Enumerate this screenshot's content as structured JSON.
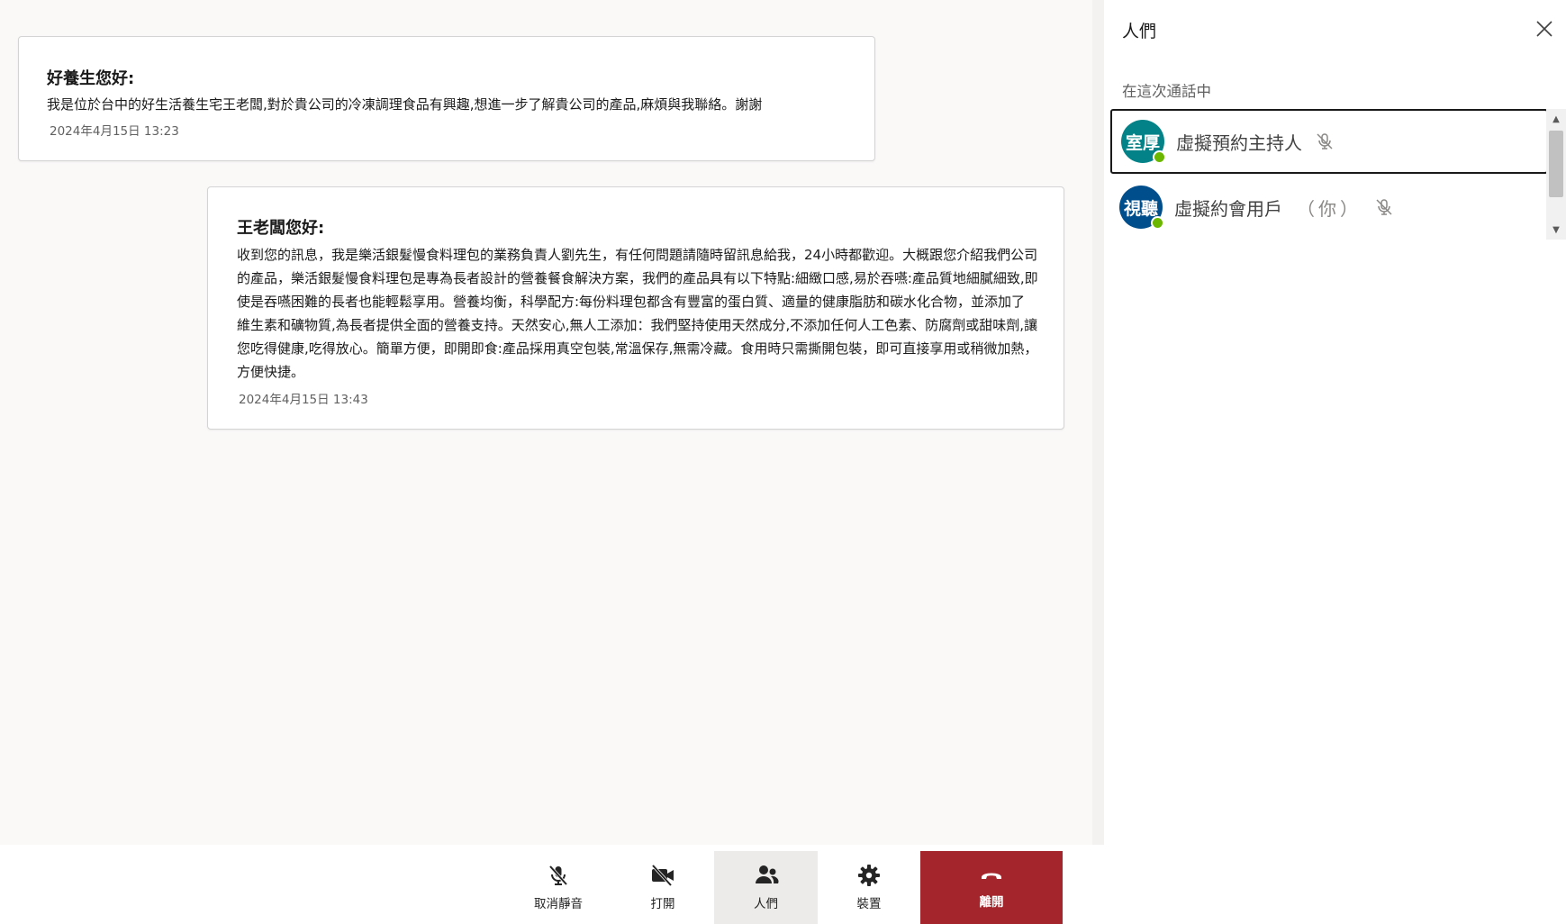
{
  "messages": [
    {
      "title": "好養生您好:",
      "body": "我是位於台中的好生活養生宅王老闆,對於貴公司的冷凍調理食品有興趣,想進一步了解貴公司的產品,麻煩與我聯絡。謝謝",
      "time": "2024年4月15日 13:23"
    },
    {
      "title": "王老闆您好:",
      "body": "收到您的訊息，我是樂活銀髮慢食料理包的業務負責人劉先生，有任何問題請隨時留訊息給我，24小時都歡迎。大概跟您介紹我們公司的產品，樂活銀髮慢食料理包是專為長者設計的營養餐食解決方案，我們的產品具有以下特點:細緻口感,易於吞嚥:產品質地細膩細致,即使是吞嚥困難的長者也能輕鬆享用。營養均衡，科學配方:每份料理包都含有豐富的蛋白質、適量的健康脂肪和碳水化合物，並添加了維生素和礦物質,為長者提供全面的營養支持。天然安心,無人工添加：我們堅持使用天然成分,不添加任何人工色素、防腐劑或甜味劑,讓您吃得健康,吃得放心。簡單方便，即開即食:產品採用真空包裝,常溫保存,無需冷藏。食用時只需撕開包裝，即可直接享用或稍微加熱，方便快捷。",
      "time": "2024年4月15日 13:43"
    }
  ],
  "panel": {
    "title": "人們",
    "close_icon": "close-icon",
    "section_label": "在這次通話中",
    "people": [
      {
        "avatar_text": "室厚",
        "avatar_color": "#038387",
        "name": "虛擬預約主持人",
        "you_label": "",
        "mic_icon": "mic-off-icon"
      },
      {
        "avatar_text": "視聽",
        "avatar_color": "#004e8c",
        "name": "虛擬約會用戶",
        "you_label": "（你）",
        "mic_icon": "mic-off-icon"
      }
    ]
  },
  "toolbar": {
    "mute_label": "取消靜音",
    "video_label": "打開",
    "people_label": "人們",
    "device_label": "裝置",
    "leave_label": "離開",
    "leave_color": "#a4262c"
  }
}
